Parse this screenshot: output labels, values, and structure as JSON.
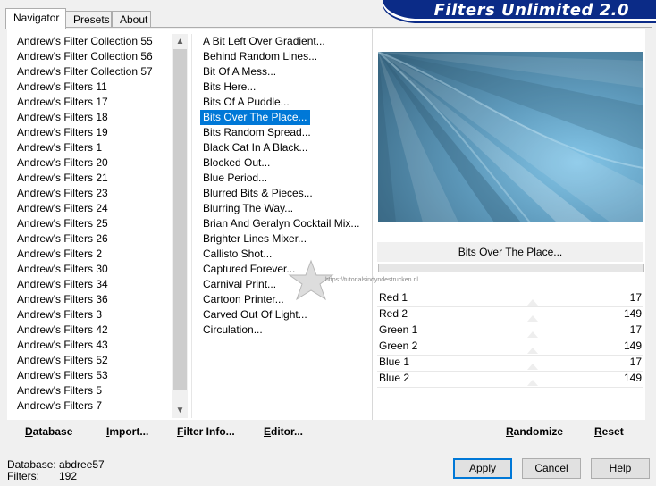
{
  "tabs": [
    {
      "label": "Navigator",
      "active": true
    },
    {
      "label": "Presets",
      "active": false
    },
    {
      "label": "About",
      "active": false
    }
  ],
  "banner_title": "Filters Unlimited 2.0",
  "categories": [
    "Andrew's Filter Collection 55",
    "Andrew's Filter Collection 56",
    "Andrew's Filter Collection 57",
    "Andrew's Filters 11",
    "Andrew's Filters 17",
    "Andrew's Filters 18",
    "Andrew's Filters 19",
    "Andrew's Filters 1",
    "Andrew's Filters 20",
    "Andrew's Filters 21",
    "Andrew's Filters 23",
    "Andrew's Filters 24",
    "Andrew's Filters 25",
    "Andrew's Filters 26",
    "Andrew's Filters 2",
    "Andrew's Filters 30",
    "Andrew's Filters 34",
    "Andrew's Filters 36",
    "Andrew's Filters 3",
    "Andrew's Filters 42",
    "Andrew's Filters 43",
    "Andrew's Filters 52",
    "Andrew's Filters 53",
    "Andrew's Filters 5",
    "Andrew's Filters 7"
  ],
  "filters": [
    "A Bit Left Over Gradient...",
    "Behind Random Lines...",
    "Bit Of A Mess...",
    "Bits Here...",
    "Bits Of A Puddle...",
    "Bits Over The Place...",
    "Bits Random Spread...",
    "Black Cat In A Black...",
    "Blocked Out...",
    "Blue Period...",
    "Blurred Bits & Pieces...",
    "Blurring The Way...",
    "Brian And Geralyn Cocktail Mix...",
    "Brighter Lines Mixer...",
    "Callisto Shot...",
    "Captured Forever...",
    "Carnival Print...",
    "Cartoon Printer...",
    "Carved Out Of Light...",
    "Circulation..."
  ],
  "selected_filter_index": 5,
  "selected_filter_name": "Bits Over The Place...",
  "parameters": [
    {
      "label": "Red 1",
      "value": "17"
    },
    {
      "label": "Red 2",
      "value": "149"
    },
    {
      "label": "Green 1",
      "value": "17"
    },
    {
      "label": "Green 2",
      "value": "149"
    },
    {
      "label": "Blue 1",
      "value": "17"
    },
    {
      "label": "Blue 2",
      "value": "149"
    }
  ],
  "toolbar": {
    "database_prefix": "D",
    "database_rest": "atabase",
    "import_prefix": "I",
    "import_rest": "mport...",
    "filter_info_prefix": "F",
    "filter_info_rest": "ilter Info...",
    "editor_prefix": "E",
    "editor_rest": "ditor...",
    "randomize_prefix": "R",
    "randomize_rest": "andomize",
    "reset_prefix": "R",
    "reset_rest": "eset"
  },
  "status": {
    "database_label": "Database:",
    "database_value": "abdree57",
    "filters_label": "Filters:",
    "filters_value": "192"
  },
  "buttons": {
    "apply": "Apply",
    "cancel": "Cancel",
    "help": "Help"
  },
  "watermark_url": "https://tutorialsindyndestrucken.nl",
  "colors": {
    "banner": "#0b2b87",
    "selection": "#0078d7",
    "preview_light": "#7fc0e2",
    "preview_dark": "#3f6f8c"
  }
}
